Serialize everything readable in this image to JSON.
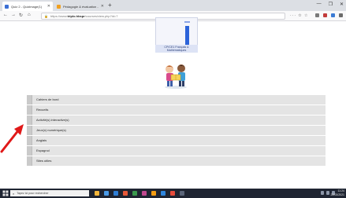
{
  "browser": {
    "tabs": [
      {
        "title": "Quiz 2 - Quizimage(1)",
        "favicon_color": "#3b6fd4",
        "active": true
      },
      {
        "title": "Pédagogie & évaluation - Quiz",
        "favicon_color": "#f0a020",
        "active": false
      }
    ],
    "new_tab_label": "+",
    "url_host": "triplo.hbspr",
    "url_prefix": "https://www.",
    "url_path": "/courses/view.php?id=7",
    "url_actions": "··· ✩ ☆",
    "window_controls": [
      "—",
      "❐",
      "✕"
    ]
  },
  "page": {
    "thumbnail_caption": "CP/CE1 Français & Mathématiques",
    "menu_items": [
      {
        "label": "Cahiers de bord"
      },
      {
        "label": "Recueils"
      },
      {
        "label": "Activité(s) interactive(s)"
      },
      {
        "label": "Jeux(x) numérique(s)"
      },
      {
        "label": "Anglais"
      },
      {
        "label": "Espagnol"
      },
      {
        "label": "Sites utiles"
      }
    ],
    "arrow_color": "#e01818"
  },
  "taskbar": {
    "search_placeholder": "Tapez ici pour rechercher",
    "clock_time": "11:24",
    "clock_date": "22/03/2021",
    "app_colors": [
      "#f4b73c",
      "#4a9be8",
      "#2f7fd6",
      "#e85a3a",
      "#3b9a4e",
      "#c0488f",
      "#f39c12",
      "#2e86de",
      "#e74c3c",
      "#5a6478"
    ]
  }
}
